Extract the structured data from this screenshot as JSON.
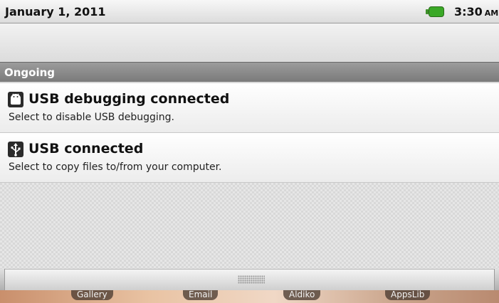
{
  "status_bar": {
    "date": "January 1, 2011",
    "time": "3:30",
    "ampm": "AM",
    "battery_color": "#3aa827"
  },
  "notifications": {
    "section_label": "Ongoing",
    "items": [
      {
        "title": "USB debugging connected",
        "subtitle": "Select to disable USB debugging.",
        "icon": "android-debug-icon"
      },
      {
        "title": "USB connected",
        "subtitle": "Select to copy files to/from your computer.",
        "icon": "usb-icon"
      }
    ]
  },
  "dock": {
    "apps": [
      "Gallery",
      "Email",
      "Aldiko",
      "AppsLib"
    ]
  }
}
